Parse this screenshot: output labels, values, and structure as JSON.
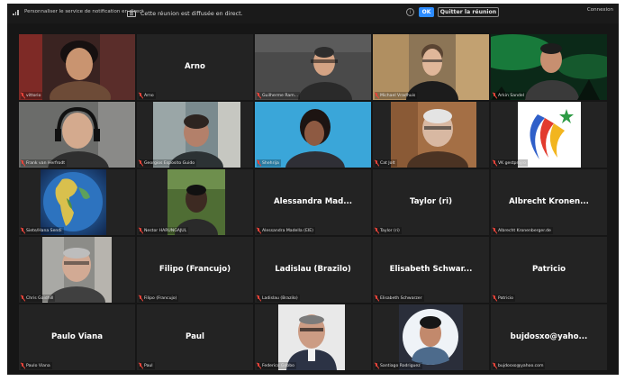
{
  "topbar": {
    "notice_text": "Personnaliser le service de notification en direct",
    "live_message": "Cette réunion est diffusée en direct.",
    "ok_label": "OK",
    "leave_label": "Quitter la réunion",
    "right_text": "Connexion"
  },
  "participants": [
    {
      "display_name": "",
      "label": "vittorio"
    },
    {
      "display_name": "Arno",
      "label": "Arno"
    },
    {
      "display_name": "",
      "label": "Guilherme Ram..."
    },
    {
      "display_name": "",
      "label": "Michael Vradhuis"
    },
    {
      "display_name": "",
      "label": "Arkin Sandel"
    },
    {
      "display_name": "",
      "label": "Frank van Herfrodt"
    },
    {
      "display_name": "",
      "label": "Georgios Esposito Guido"
    },
    {
      "display_name": "",
      "label": "Shehrija"
    },
    {
      "display_name": "",
      "label": "Cat Jolt"
    },
    {
      "display_name": "",
      "label": "VK gestprojro"
    },
    {
      "display_name": "",
      "label": "Siete/Hana Sendi"
    },
    {
      "display_name": "",
      "label": "Nestor HARUNGAJUL"
    },
    {
      "display_name": "Alessandra Mad...",
      "label": "Alessandra Madella (EIE)"
    },
    {
      "display_name": "Taylor (ri)",
      "label": "Taylor (ri)"
    },
    {
      "display_name": "Albrecht Kronen...",
      "label": "Albrecht Kronenberger.de"
    },
    {
      "display_name": "",
      "label": "Chris Gaidhill"
    },
    {
      "display_name": "Filipo (Francujo)",
      "label": "Filipo (Francujo)"
    },
    {
      "display_name": "Ladislau (Brazilo)",
      "label": "Ladislau (Brazilo)"
    },
    {
      "display_name": "Elisabeth Schwar...",
      "label": "Elisabeth Schwarzer"
    },
    {
      "display_name": "Patricio",
      "label": "Patricio"
    },
    {
      "display_name": "Paulo Viana",
      "label": "Paulo Viana"
    },
    {
      "display_name": "Paul",
      "label": "Paul"
    },
    {
      "display_name": "",
      "label": "Federico Gobbo"
    },
    {
      "display_name": "",
      "label": "Santiago Rodriguez"
    },
    {
      "display_name": "bujdosxo@yaho...",
      "label": "bujdosxo@yahoo.com"
    }
  ],
  "colors": {
    "active_border": "#c6cf5a",
    "ok_blue": "#2d8cff",
    "mic_red": "#e8443a"
  }
}
